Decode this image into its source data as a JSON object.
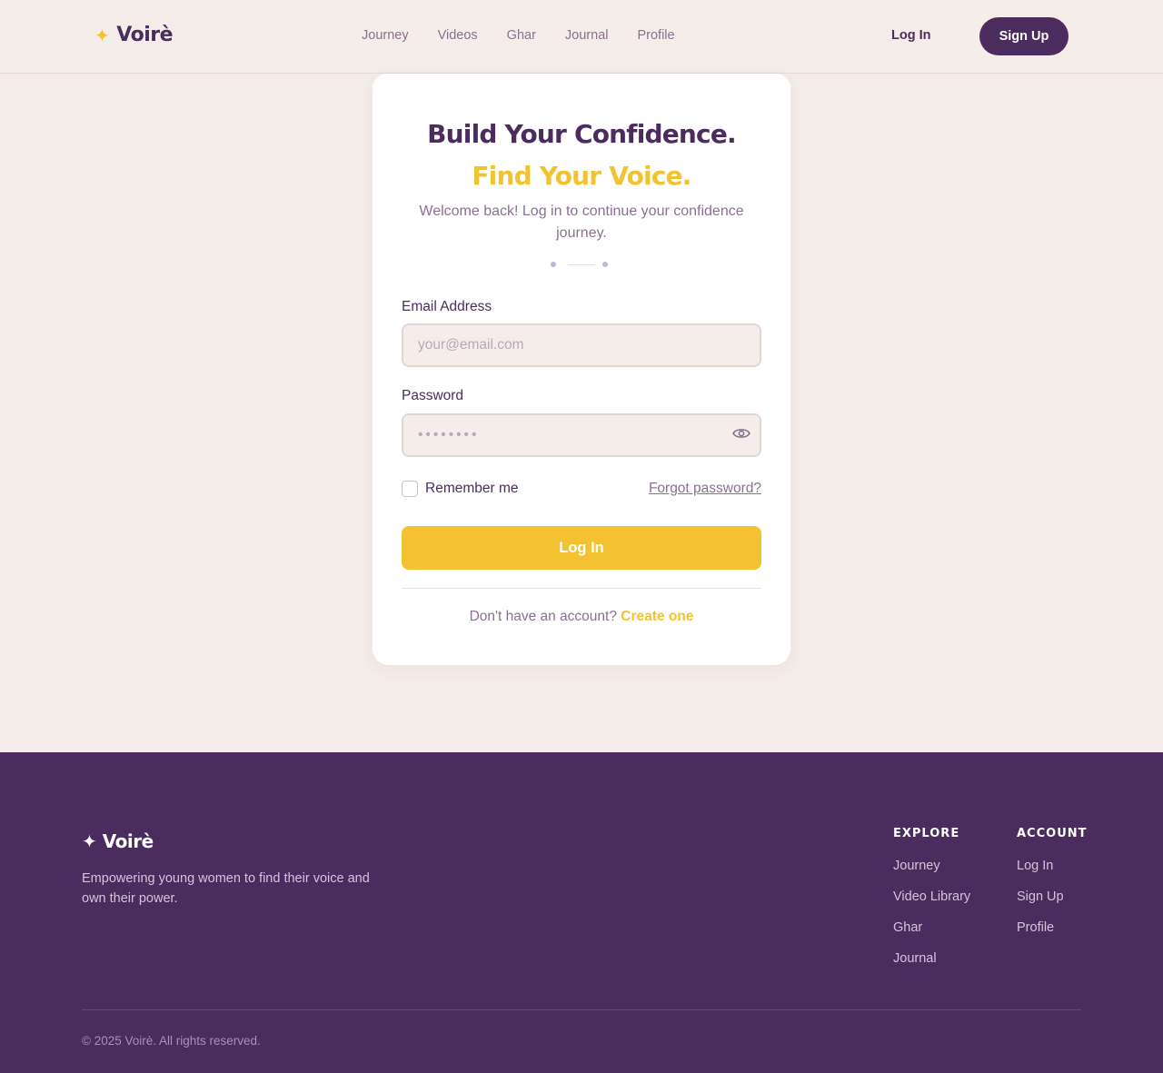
{
  "brand": {
    "name": "Voirè",
    "accent": "#f2c230",
    "primary": "#4a2c5e",
    "background": "#f5ede9"
  },
  "header": {
    "nav": [
      "Journey",
      "Videos",
      "Ghar",
      "Journal",
      "Profile"
    ],
    "login": "Log In",
    "signup": "Sign Up"
  },
  "card": {
    "title_main": "Build Your Confidence.",
    "title_accent": "Find Your Voice.",
    "subtitle": "Welcome back! Log in to continue your confidence journey.",
    "email_label": "Email Address",
    "email_placeholder": "your@email.com",
    "password_label": "Password",
    "password_placeholder": "••••••••",
    "remember": "Remember me",
    "forgot": "Forgot password?",
    "submit": "Log In",
    "no_account": "Don't have an account?",
    "create": "Create one"
  },
  "footer": {
    "brand": "Voirè",
    "tagline": "Empowering young women to find their voice and own their power.",
    "explore_heading": "EXPLORE",
    "explore": [
      "Journey",
      "Video Library",
      "Ghar",
      "Journal"
    ],
    "account_heading": "ACCOUNT",
    "account": [
      "Log In",
      "Sign Up",
      "Profile"
    ],
    "copyright": "© 2025 Voirè. All rights reserved."
  }
}
